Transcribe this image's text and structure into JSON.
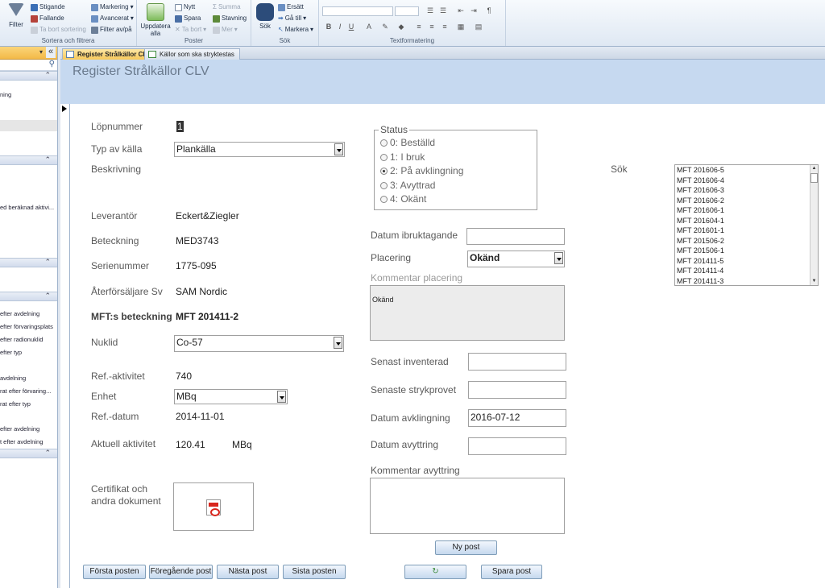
{
  "ribbon": {
    "sort_filter": {
      "filter": "Filter",
      "ascending": "Stigande",
      "descending": "Fallande",
      "remove_sort": "Ta bort sortering",
      "selection": "Markering",
      "advanced": "Avancerat",
      "toggle_filter": "Filter av/på",
      "group": "Sortera och filtrera"
    },
    "records": {
      "refresh": "Uppdatera",
      "refresh2": "alla",
      "new": "Nytt",
      "save": "Spara",
      "delete": "Ta bort",
      "totals": "Summa",
      "spelling": "Stavning",
      "more": "Mer",
      "group": "Poster"
    },
    "find": {
      "find": "Sök",
      "replace": "Ersätt",
      "goto": "Gå till",
      "select": "Markera",
      "group": "Sök"
    },
    "text_format": {
      "group": "Textformatering"
    }
  },
  "nav": {
    "items": [
      "ning",
      "ed beräknad aktivi...",
      "efter avdelning",
      "efter förvaringsplats",
      "efter radionuklid",
      "efter typ",
      "avdelning",
      "rat efter förvaring...",
      "rat efter typ",
      "efter avdelning",
      "t efter avdelning"
    ]
  },
  "tabs": [
    {
      "label": "Register Strålkällor CLV"
    },
    {
      "label": "Källor som ska stryktestas"
    }
  ],
  "form": {
    "title": "Register Strålkällor CLV",
    "lopnummer": {
      "label": "Löpnummer",
      "value": "1"
    },
    "typ": {
      "label": "Typ av källa",
      "value": "Plankälla"
    },
    "beskrivning": {
      "label": "Beskrivning"
    },
    "leverantor": {
      "label": "Leverantör",
      "value": "Eckert&Ziegler"
    },
    "beteckning": {
      "label": "Beteckning",
      "value": "MED3743"
    },
    "serienummer": {
      "label": "Serienummer",
      "value": "1775-095"
    },
    "aterforsaljare": {
      "label": "Återförsäljare Sv",
      "value": "SAM Nordic"
    },
    "mft": {
      "label": "MFT:s beteckning",
      "value": "MFT 201411-2"
    },
    "nuklid": {
      "label": "Nuklid",
      "value": "Co-57"
    },
    "refakt": {
      "label": "Ref.-aktivitet",
      "value": "740"
    },
    "enhet": {
      "label": "Enhet",
      "value": "MBq"
    },
    "refdatum": {
      "label": "Ref.-datum",
      "value": "2014-11-01"
    },
    "aktuell": {
      "label": "Aktuell aktivitet",
      "value": "120.41",
      "unit": "MBq"
    },
    "cert": {
      "label1": "Certifikat och",
      "label2": "andra dokument"
    },
    "status": {
      "label": "Status",
      "options": [
        "0: Beställd",
        "1: I bruk",
        "2: På avklingning",
        "3: Avyttrad",
        "4: Okänt"
      ],
      "selected": 2
    },
    "datum_ibruk": {
      "label": "Datum ibruktagande",
      "value": ""
    },
    "placering": {
      "label": "Placering",
      "value": "Okänd"
    },
    "kommentar_placering": {
      "label": "Kommentar placering",
      "value": "Okänd"
    },
    "senast_inv": {
      "label": "Senast inventerad",
      "value": ""
    },
    "senaste_stryk": {
      "label": "Senaste strykprovet",
      "value": ""
    },
    "datum_avkl": {
      "label": "Datum avklingning",
      "value": "2016-07-12"
    },
    "datum_avytt": {
      "label": "Datum avyttring",
      "value": ""
    },
    "kommentar_avytt": {
      "label": "Kommentar avyttring",
      "value": ""
    },
    "sok": {
      "label": "Sök"
    },
    "list": [
      "MFT 201606-5",
      "MFT 201606-4",
      "MFT 201606-3",
      "MFT 201606-2",
      "MFT 201606-1",
      "MFT 201604-1",
      "MFT 201601-1",
      "MFT 201506-2",
      "MFT 201506-1",
      "MFT 201411-5",
      "MFT 201411-4",
      "MFT 201411-3"
    ]
  },
  "buttons": {
    "first": "Första posten",
    "prev": "Föregående post",
    "next": "Nästa post",
    "last": "Sista posten",
    "new": "Ny post",
    "save": "Spara post"
  }
}
